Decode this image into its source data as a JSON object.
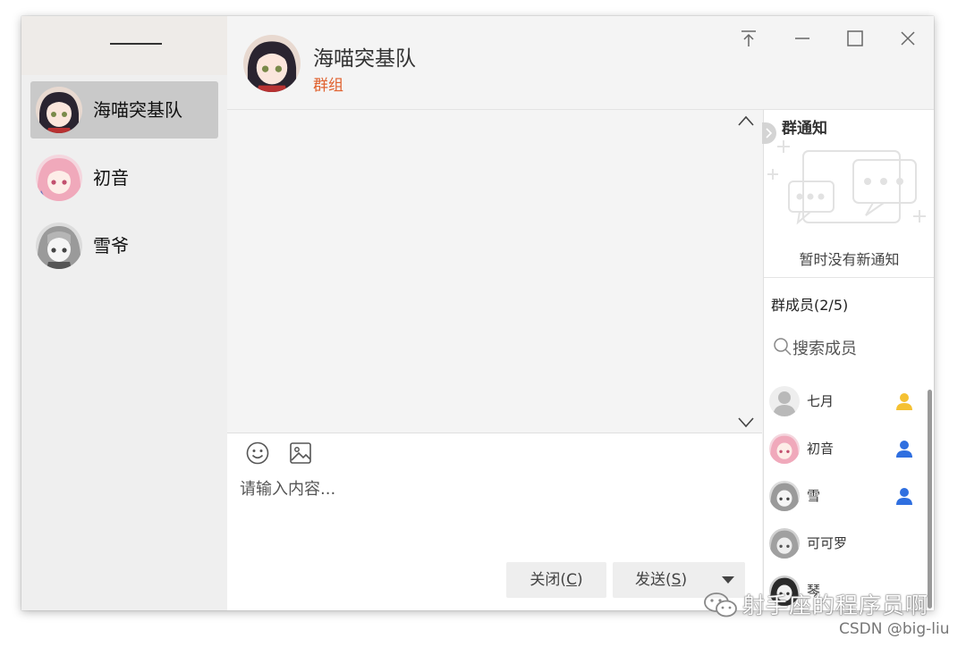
{
  "sidebar": {
    "items": [
      {
        "name": "海喵突基队",
        "active": true
      },
      {
        "name": "初音",
        "active": false
      },
      {
        "name": "雪爷",
        "active": false
      }
    ]
  },
  "header": {
    "title": "海喵突基队",
    "subtitle": "群组"
  },
  "composer": {
    "placeholder": "请输入内容...",
    "close_label_prefix": "关闭(",
    "close_key": "C",
    "close_label_suffix": ")",
    "send_label_prefix": "发送(",
    "send_key": "S",
    "send_label_suffix": ")"
  },
  "notice": {
    "title": "群通知",
    "empty_text": "暂时没有新通知"
  },
  "members": {
    "title": "群成员(2/5)",
    "search_placeholder": "搜索成员",
    "list": [
      {
        "name": "七月",
        "role": "owner",
        "role_color": "#f5c132"
      },
      {
        "name": "初音",
        "role": "admin",
        "role_color": "#2f6fe0"
      },
      {
        "name": "雪",
        "role": "admin",
        "role_color": "#2f6fe0"
      },
      {
        "name": "可可罗",
        "role": "",
        "role_color": ""
      },
      {
        "name": "琴",
        "role": "",
        "role_color": ""
      }
    ]
  },
  "watermark": {
    "line1": "射手座的程序员啊",
    "line2": "CSDN @big-liu"
  },
  "colors": {
    "accent": "#e0622f",
    "owner_icon": "#f5c132",
    "admin_icon": "#2f6fe0"
  }
}
